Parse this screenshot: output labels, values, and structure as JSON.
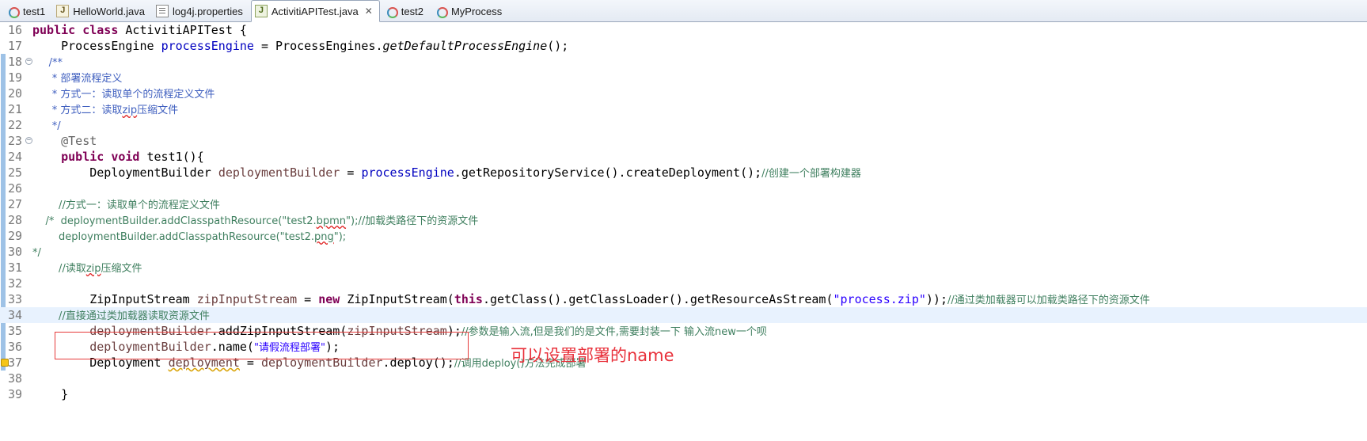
{
  "tabs": [
    {
      "label": "test1",
      "icon": "process-diagram-icon",
      "active": false
    },
    {
      "label": "HelloWorld.java",
      "icon": "java-file-icon",
      "active": false
    },
    {
      "label": "log4j.properties",
      "icon": "properties-file-icon",
      "active": false
    },
    {
      "label": "ActivitiAPITest.java",
      "icon": "java-test-file-icon",
      "active": true,
      "close": "✕"
    },
    {
      "label": "test2",
      "icon": "process-diagram-icon",
      "active": false
    },
    {
      "label": "MyProcess",
      "icon": "process-diagram-icon",
      "active": false
    }
  ],
  "editor": {
    "current_line": 34,
    "lines": [
      {
        "n": "16",
        "parts": [
          [
            "kw",
            "public class "
          ],
          [
            "plain",
            "ActivitiAPITest {"
          ]
        ]
      },
      {
        "n": "17",
        "parts": [
          [
            "plain",
            "    ProcessEngine "
          ],
          [
            "fld",
            "processEngine"
          ],
          [
            "plain",
            " = ProcessEngines."
          ],
          [
            "ital",
            "getDefaultProcessEngine"
          ],
          [
            "plain",
            "();"
          ]
        ]
      },
      {
        "n": "18",
        "fold": "⊖",
        "parts": [
          [
            "jdoc",
            "     /**"
          ]
        ]
      },
      {
        "n": "19",
        "parts": [
          [
            "jdoc",
            "      * 部署流程定义"
          ]
        ]
      },
      {
        "n": "20",
        "parts": [
          [
            "jdoc",
            "      * 方式一：读取单个的流程定义文件"
          ]
        ]
      },
      {
        "n": "21",
        "parts": [
          [
            "jdoc",
            "      * 方式二：读取"
          ],
          [
            "jdoc-err",
            "zip"
          ],
          [
            "jdoc",
            "压缩文件"
          ]
        ]
      },
      {
        "n": "22",
        "parts": [
          [
            "jdoc",
            "      */"
          ]
        ]
      },
      {
        "n": "23",
        "fold": "⊖",
        "parts": [
          [
            "ann",
            "    @Test"
          ]
        ]
      },
      {
        "n": "24",
        "parts": [
          [
            "plain",
            "    "
          ],
          [
            "kw",
            "public void "
          ],
          [
            "plain",
            "test1(){"
          ]
        ]
      },
      {
        "n": "25",
        "parts": [
          [
            "plain",
            "        DeploymentBuilder "
          ],
          [
            "var",
            "deploymentBuilder"
          ],
          [
            "plain",
            " = "
          ],
          [
            "fld",
            "processEngine"
          ],
          [
            "plain",
            ".getRepositoryService().createDeployment();"
          ],
          [
            "com",
            "//创建一个部署构建器"
          ]
        ]
      },
      {
        "n": "26",
        "parts": []
      },
      {
        "n": "27",
        "parts": [
          [
            "com",
            "        //方式一：读取单个的流程定义文件"
          ]
        ]
      },
      {
        "n": "28",
        "parts": [
          [
            "com",
            "    /*  deploymentBuilder.addClasspathResource(\"test2."
          ],
          [
            "com-err",
            "bpmn"
          ],
          [
            "com",
            "\");//加载类路径下的资源文件"
          ]
        ]
      },
      {
        "n": "29",
        "parts": [
          [
            "com",
            "        deploymentBuilder.addClasspathResource(\"test2."
          ],
          [
            "com-err",
            "png"
          ],
          [
            "com",
            "\");"
          ]
        ]
      },
      {
        "n": "30",
        "parts": [
          [
            "com",
            "*/"
          ]
        ]
      },
      {
        "n": "31",
        "parts": [
          [
            "com",
            "        //读取"
          ],
          [
            "com-err",
            "zip"
          ],
          [
            "com",
            "压缩文件"
          ]
        ]
      },
      {
        "n": "32",
        "parts": []
      },
      {
        "n": "33",
        "parts": [
          [
            "plain",
            "        ZipInputStream "
          ],
          [
            "var",
            "zipInputStream"
          ],
          [
            "plain",
            " = "
          ],
          [
            "kw",
            "new "
          ],
          [
            "plain",
            "ZipInputStream("
          ],
          [
            "kw",
            "this"
          ],
          [
            "plain",
            ".getClass().getClassLoader().getResourceAsStream("
          ],
          [
            "str",
            "\"process.zip\""
          ],
          [
            "plain",
            "));"
          ],
          [
            "com",
            "//通过类加载器可以加载类路径下的资源文件"
          ]
        ]
      },
      {
        "n": "34",
        "parts": [
          [
            "com",
            "        //直接通过类加载器读取资源文件"
          ]
        ]
      },
      {
        "n": "35",
        "parts": [
          [
            "plain",
            "        "
          ],
          [
            "var",
            "deploymentBuilder"
          ],
          [
            "plain",
            ".addZipInputStream("
          ],
          [
            "var",
            "zipInputStream"
          ],
          [
            "plain",
            ");"
          ],
          [
            "com",
            "//参数是输入流,但是我们的是文件,需要封装一下 输入流new一个呗"
          ]
        ]
      },
      {
        "n": "36",
        "parts": [
          [
            "plain",
            "        "
          ],
          [
            "var",
            "deploymentBuilder"
          ],
          [
            "plain",
            ".name("
          ],
          [
            "str",
            "\"请假流程部署\""
          ],
          [
            "plain",
            ");"
          ]
        ]
      },
      {
        "n": "37",
        "warn": true,
        "parts": [
          [
            "plain",
            "        Deployment "
          ],
          [
            "var-warn",
            "deployment"
          ],
          [
            "plain",
            " = "
          ],
          [
            "var",
            "deploymentBuilder"
          ],
          [
            "plain",
            ".deploy();"
          ],
          [
            "com",
            "//调用deploy()方法完成部署"
          ]
        ]
      },
      {
        "n": "38",
        "parts": []
      },
      {
        "n": "39",
        "parts": [
          [
            "plain",
            "    }"
          ]
        ]
      }
    ]
  },
  "annotation": {
    "text": "可以设置部署的name",
    "color": "#e8303a"
  }
}
